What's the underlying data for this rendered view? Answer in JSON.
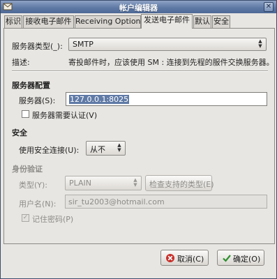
{
  "window": {
    "title": "帐户编辑器",
    "close_glyph": "✕"
  },
  "tabs": [
    {
      "label": "标识"
    },
    {
      "label": "接收电子邮件"
    },
    {
      "label": "Receiving Options"
    },
    {
      "label": "发送电子邮件"
    },
    {
      "label": "默认"
    },
    {
      "label": "安全"
    }
  ],
  "server_type": {
    "label": "服务器类型(_):",
    "value": "SMTP"
  },
  "description": {
    "label": "描述:",
    "text": "寄投邮件时，应该使用 SM   : 连接到先程的服件交换服务器。"
  },
  "server_config": {
    "heading": "服务器配置",
    "server_label": "服务器(S):",
    "server_value": "127.0.0.1:8025",
    "auth_required_label": "服务器需要认证(V)",
    "auth_required_checked": false
  },
  "security": {
    "heading": "安全",
    "secure_conn_label": "使用安全连接(U):",
    "secure_conn_value": "从不"
  },
  "auth": {
    "heading": "身份验证",
    "type_label": "类型(Y):",
    "type_value": "PLAIN",
    "check_types_button": "检查支持的类型(E)",
    "username_label": "用户名(N):",
    "username_value": "sir_tu2003@hotmail.com",
    "remember_password_label": "记住密码(P)",
    "remember_password_checked": true
  },
  "footer": {
    "cancel_label": "取消(C)",
    "ok_label": "确定(O)"
  },
  "colors": {
    "titlebar": "#5f7aa6",
    "selection": "#5f7aa6",
    "cancel_icon": "#c8302a",
    "ok_icon": "#2f8f2f"
  }
}
